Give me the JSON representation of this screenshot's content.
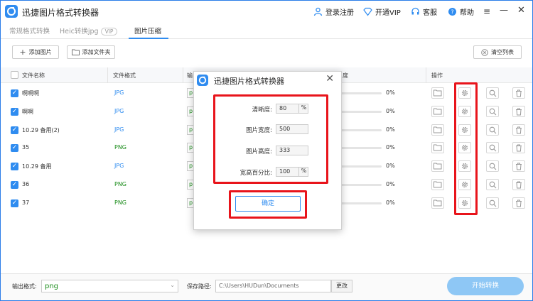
{
  "app": {
    "title": "迅捷图片格式转换器",
    "actions": [
      "登录注册",
      "开通VIP",
      "客服",
      "帮助"
    ]
  },
  "tabs": [
    {
      "label": "常规格式转换"
    },
    {
      "label": "Heic转换jpg",
      "badge": "VIP"
    },
    {
      "label": "图片压缩"
    }
  ],
  "toolbar": {
    "add_image": "添加图片",
    "add_folder": "添加文件夹",
    "clear_list": "清空列表"
  },
  "table": {
    "headers": [
      "文件名称",
      "文件格式",
      "输",
      "度",
      "操作"
    ],
    "rows": [
      {
        "name": "啊啊啊",
        "format": "JPG",
        "out": "p",
        "progress": "0%"
      },
      {
        "name": "啊啊",
        "format": "JPG",
        "out": "p",
        "progress": "0%"
      },
      {
        "name": "10.29 备用(2)",
        "format": "JPG",
        "out": "p",
        "progress": "0%"
      },
      {
        "name": "35",
        "format": "PNG",
        "out": "p",
        "progress": "0%"
      },
      {
        "name": "10.29 备用",
        "format": "JPG",
        "out": "p",
        "progress": "0%"
      },
      {
        "name": "36",
        "format": "PNG",
        "out": "p",
        "progress": "0%"
      },
      {
        "name": "37",
        "format": "PNG",
        "out": "p",
        "progress": "0%"
      }
    ]
  },
  "dialog": {
    "title": "迅捷图片格式转换器",
    "fields": [
      {
        "label": "清晰度:",
        "value": "80",
        "unit": "%"
      },
      {
        "label": "图片宽度:",
        "value": "500",
        "unit": ""
      },
      {
        "label": "图片高度:",
        "value": "333",
        "unit": ""
      },
      {
        "label": "宽高百分比:",
        "value": "100",
        "unit": "%"
      }
    ],
    "confirm": "确定"
  },
  "bottom": {
    "output_format_label": "输出格式:",
    "output_format_value": "png",
    "save_path_label": "保存路径:",
    "save_path_value": "C:\\Users\\HUDun\\Documents",
    "change_label": "更改",
    "start_label": "开始转换"
  },
  "colors": {
    "accent": "#2f8cf0",
    "highlight": "#e8141b",
    "png_text": "#1a8c1a"
  }
}
